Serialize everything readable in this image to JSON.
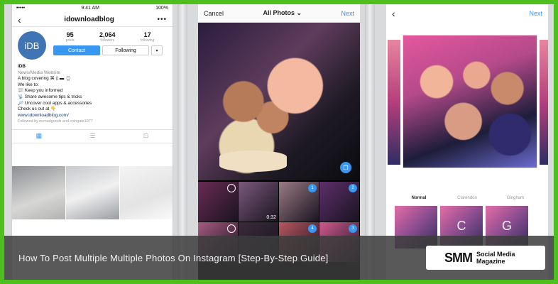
{
  "colors": {
    "accent": "#3897f0",
    "brand_green": "#4fbf1f"
  },
  "phone1": {
    "status": {
      "signal": "•••••",
      "time": "9:41 AM",
      "battery": "100%"
    },
    "nav": {
      "back_icon": "chevron-left-icon",
      "username": "idownloadblog",
      "more_icon": "more-dots-icon"
    },
    "avatar_text": "iDB",
    "stats": [
      {
        "value": "95",
        "label": "posts"
      },
      {
        "value": "2,064",
        "label": "followers"
      },
      {
        "value": "17",
        "label": "following"
      }
    ],
    "buttons": {
      "contact": "Contact",
      "following": "Following",
      "dropdown": "▾"
    },
    "bio": {
      "name": "iDB",
      "category": "News/Media Website",
      "lines": [
        "A blog covering  ⌘ ▯ ▬ ⌚",
        "We like to:",
        "📰 Keep you informed",
        "📡 Share awesome tips & tricks",
        "🔎 Uncover cool apps & accessories",
        "Check us out at 👇"
      ],
      "link": "www.idownloadblog.com/",
      "followed_by": "Followed by nomadgoods and coingate1977"
    }
  },
  "phone2": {
    "nav": {
      "cancel": "Cancel",
      "title": "All Photos",
      "chevron": "⌄",
      "next": "Next"
    },
    "grid": [
      {
        "duration": "",
        "number": "",
        "ring": true,
        "color": "#6a2b54"
      },
      {
        "duration": "0:32",
        "number": "",
        "ring": false,
        "color": "#7b5a7c"
      },
      {
        "duration": "",
        "number": "1",
        "ring": false,
        "color": "#9a7b84"
      },
      {
        "duration": "",
        "number": "2",
        "ring": false,
        "color": "#5d2f6b"
      },
      {
        "duration": "",
        "number": "",
        "ring": true,
        "color": "#a65a7f"
      },
      {
        "duration": "0:04",
        "number": "",
        "ring": false,
        "color": "#3a2b3a"
      },
      {
        "duration": "",
        "number": "4",
        "ring": false,
        "color": "#b8565f"
      },
      {
        "duration": "",
        "number": "3",
        "ring": false,
        "color": "#d0598f"
      }
    ]
  },
  "phone3": {
    "nav": {
      "back_icon": "chevron-left-icon",
      "next": "Next"
    },
    "filters": [
      "Normal",
      "Clarendon",
      "Gingham"
    ],
    "thumb_letters": [
      "",
      "C",
      "G"
    ]
  },
  "banner": {
    "title": "How To Post Multiple Multiple Photos On Instagram [Step-By-Step Guide]",
    "logo_mark": "SMM",
    "logo_line1": "Social Media",
    "logo_line2": "Magazine"
  }
}
